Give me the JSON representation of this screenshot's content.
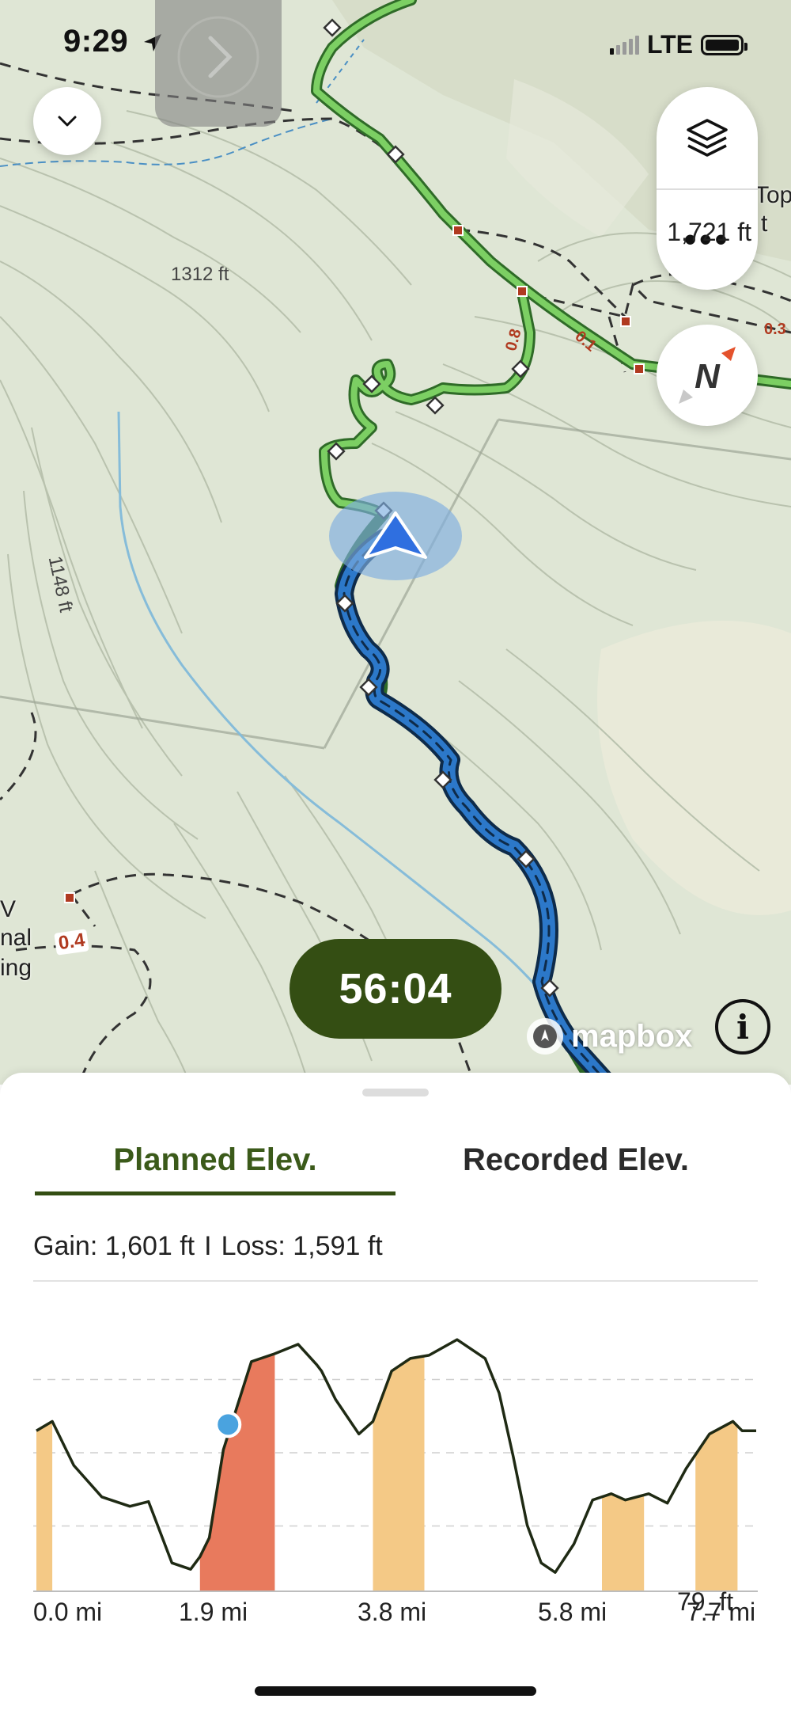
{
  "status_bar": {
    "time": "9:29",
    "network": "LTE"
  },
  "map": {
    "labels": [
      "1312 ft",
      "1148 ft",
      "0.8",
      "0.1",
      "0.3",
      "0.4",
      "nal",
      "ing",
      "Top",
      "t",
      "V"
    ],
    "timer": "56:04",
    "attribution": "mapbox",
    "info_icon": "i",
    "more_icon": "•••",
    "compass_letter": "N",
    "colors": {
      "planned_route": "#3f8f35",
      "recorded_route": "#2c78c9",
      "trail_dashed": "#333333",
      "water": "#7fb6d8",
      "position_marker": "#2f6fe0",
      "timer_bg": "#344e13"
    }
  },
  "sheet": {
    "tabs": [
      {
        "label": "Planned Elev.",
        "active": true
      },
      {
        "label": "Recorded Elev.",
        "active": false
      }
    ],
    "gain_label": "Gain: 1,601 ft",
    "loss_label": "Loss: 1,591 ft",
    "separator": "I"
  },
  "chart_data": {
    "type": "area",
    "xlabel": "",
    "ylabel": "",
    "x_ticks": [
      "0.0 mi",
      "1.9 mi",
      "3.8 mi",
      "5.8 mi",
      "7.7 mi"
    ],
    "y_max_label": "1,721 ft",
    "y_min_label": "79_ft",
    "ylim": [
      790,
      1721
    ],
    "xlim": [
      0,
      7.7
    ],
    "series": [
      {
        "x": [
          0,
          0.17,
          0.4,
          0.7,
          1.0,
          1.2,
          1.45,
          1.65,
          1.75,
          1.85,
          2.0,
          2.3,
          2.55,
          2.8,
          3.0,
          3.05,
          3.2,
          3.45,
          3.6,
          3.8,
          4.0,
          4.2,
          4.5,
          4.8,
          4.95,
          5.1,
          5.25,
          5.4,
          5.55,
          5.75,
          5.95,
          6.15,
          6.3,
          6.55,
          6.75,
          6.95,
          7.2,
          7.45,
          7.55,
          7.7
        ],
        "y": [
          1300,
          1330,
          1190,
          1090,
          1060,
          1075,
          880,
          860,
          900,
          960,
          1240,
          1520,
          1545,
          1575,
          1510,
          1490,
          1400,
          1290,
          1330,
          1490,
          1530,
          1540,
          1590,
          1530,
          1420,
          1220,
          1000,
          880,
          850,
          940,
          1080,
          1100,
          1080,
          1100,
          1070,
          1180,
          1290,
          1330,
          1300,
          1300
        ]
      }
    ],
    "marker": {
      "x": 2.05,
      "y": 1320
    },
    "shaded_bands": [
      {
        "from": 0.0,
        "to": 0.17,
        "color": "#f4c986"
      },
      {
        "from": 1.75,
        "to": 2.55,
        "color": "#e87a5d"
      },
      {
        "from": 3.6,
        "to": 4.15,
        "color": "#f4c986"
      },
      {
        "from": 6.05,
        "to": 6.5,
        "color": "#f4c986"
      },
      {
        "from": 7.05,
        "to": 7.5,
        "color": "#f4c986"
      }
    ],
    "grid": true
  }
}
